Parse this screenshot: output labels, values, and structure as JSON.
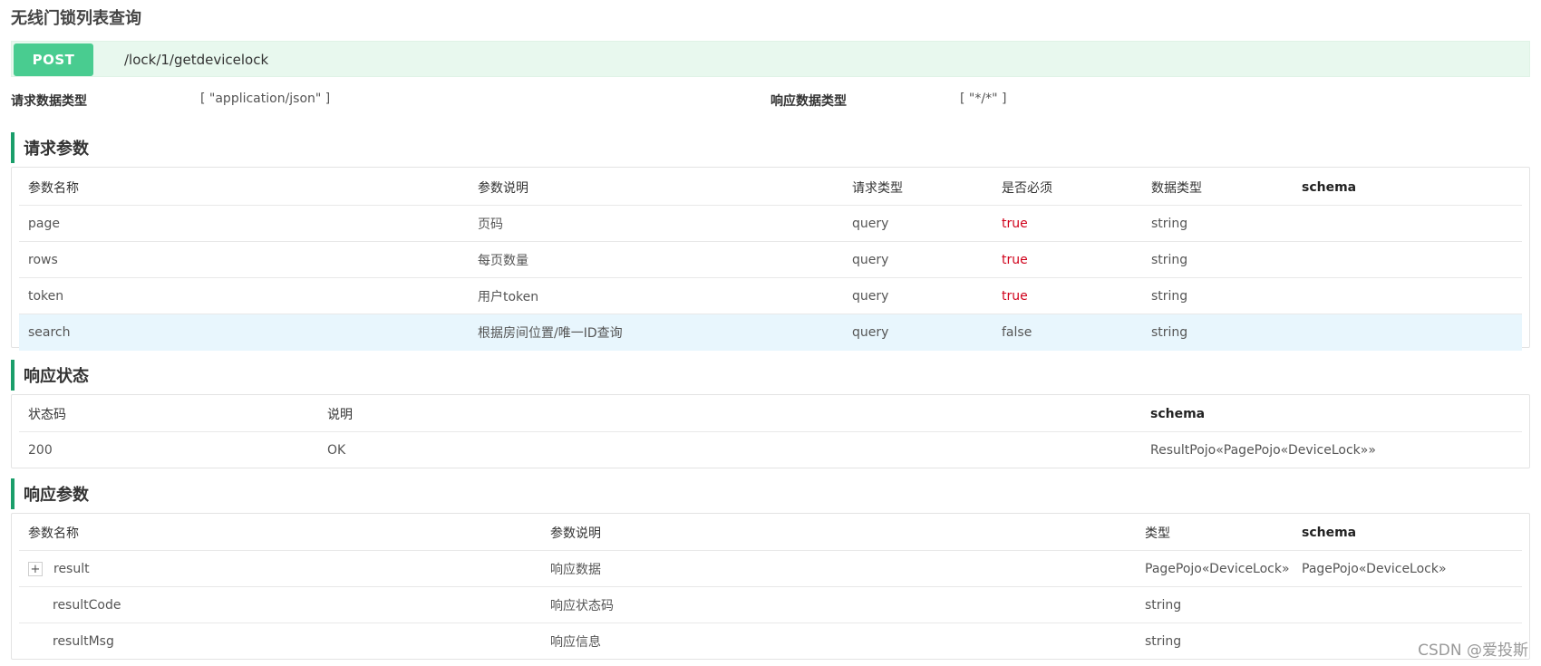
{
  "page_title": "无线门锁列表查询",
  "endpoint": {
    "method": "POST",
    "path": "/lock/1/getdevicelock"
  },
  "content_types": {
    "request_label": "请求数据类型",
    "request_value": "[ \"application/json\" ]",
    "response_label": "响应数据类型",
    "response_value": "[ \"*/*\" ]"
  },
  "request_params": {
    "heading": "请求参数",
    "headers": [
      "参数名称",
      "参数说明",
      "请求类型",
      "是否必须",
      "数据类型",
      "schema"
    ],
    "rows": [
      [
        "page",
        "页码",
        "query",
        "true",
        "string",
        ""
      ],
      [
        "rows",
        "每页数量",
        "query",
        "true",
        "string",
        ""
      ],
      [
        "token",
        "用户token",
        "query",
        "true",
        "string",
        ""
      ],
      [
        "search",
        "根据房间位置/唯一ID查询",
        "query",
        "false",
        "string",
        ""
      ]
    ]
  },
  "response_status": {
    "heading": "响应状态",
    "headers": [
      "状态码",
      "说明",
      "schema"
    ],
    "rows": [
      [
        "200",
        "OK",
        "ResultPojo«PagePojo«DeviceLock»»"
      ]
    ]
  },
  "response_params": {
    "heading": "响应参数",
    "headers": [
      "参数名称",
      "参数说明",
      "类型",
      "schema"
    ],
    "rows": [
      [
        "result",
        "响应数据",
        "PagePojo«DeviceLock»",
        "PagePojo«DeviceLock»"
      ],
      [
        "resultCode",
        "响应状态码",
        "string",
        ""
      ],
      [
        "resultMsg",
        "响应信息",
        "string",
        ""
      ]
    ],
    "expand_symbol": "+"
  },
  "watermark": "CSDN @爱投斯",
  "colors": {
    "post_badge": "#49cc90",
    "endpoint_bg": "#e8f8ee",
    "section_accent": "#1a9e6a",
    "required_true": "#d0021b",
    "hover_row": "#e8f6fd"
  }
}
